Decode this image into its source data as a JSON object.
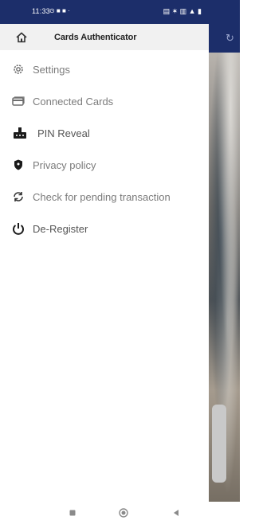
{
  "status_bar": {
    "time": "11:33",
    "left_icons": "⊙ ■ ■ ·",
    "right_icons": "▤ ✶ ▥ ▲ ▮"
  },
  "drawer": {
    "header": {
      "title": "Cards Authenticator",
      "icon": "home-icon"
    },
    "items": [
      {
        "label": "Settings",
        "icon": "gear-icon"
      },
      {
        "label": "Connected Cards",
        "icon": "cards-icon"
      },
      {
        "label": "PIN Reveal",
        "icon": "pin-reveal-icon"
      },
      {
        "label": "Privacy policy",
        "icon": "shield-icon"
      },
      {
        "label": "Check for pending transaction",
        "icon": "refresh-icon"
      },
      {
        "label": "De-Register",
        "icon": "power-icon"
      }
    ]
  },
  "nav_bar": {
    "buttons": [
      "recent-apps-icon",
      "home-button-icon",
      "back-icon"
    ]
  },
  "colors": {
    "status_bar": "#1c2e6a",
    "drawer_header_bg": "#f1f1f1",
    "menu_text": "#7b7b7b"
  }
}
